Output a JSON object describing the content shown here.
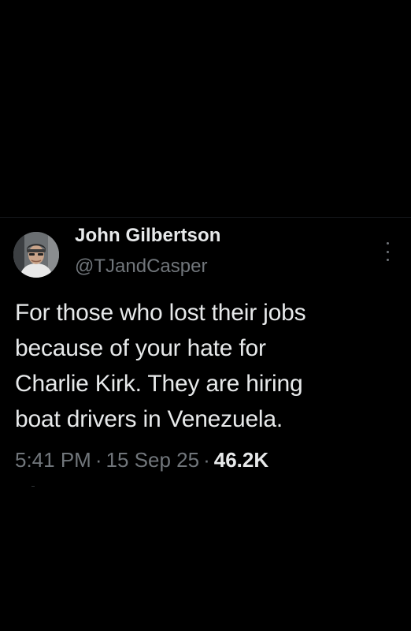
{
  "tweet": {
    "display_name": "John Gilbertson",
    "handle": "@TJandCasper",
    "text_lines": [
      "For those who lost their jobs",
      "because of your hate for",
      "Charlie Kirk. They are hiring",
      "boat drivers in Venezuela."
    ],
    "time": "5:41 PM",
    "separator": "·",
    "date": "15 Sep 25",
    "views": "46.2K"
  },
  "icons": {
    "more": "more-vertical-icon",
    "avatar": "profile-photo"
  },
  "colors": {
    "background": "#000000",
    "primary_text": "#e7e9ea",
    "secondary_text": "#71767b"
  }
}
